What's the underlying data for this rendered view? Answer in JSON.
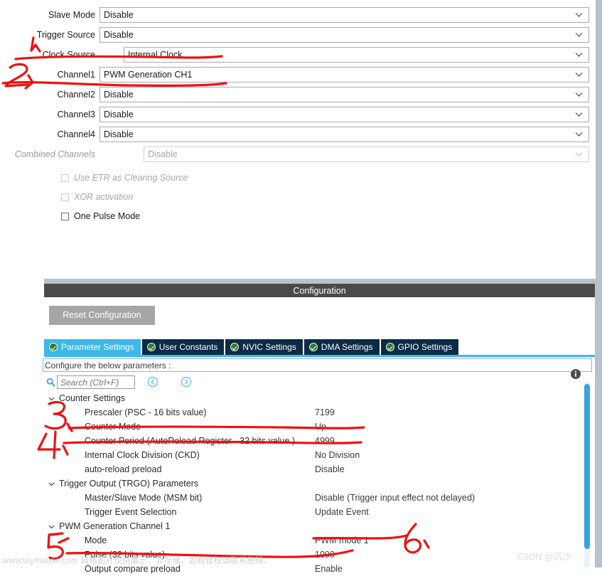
{
  "top_panel": {
    "rows": [
      {
        "label": "Slave Mode",
        "value": "Disable",
        "disabled": false,
        "value_indent": 0
      },
      {
        "label": "Trigger Source",
        "value": "Disable",
        "disabled": false,
        "value_indent": 0
      },
      {
        "label": "Clock Source",
        "value": "Internal Clock",
        "disabled": false,
        "value_indent": 34
      },
      {
        "label": "Channel1",
        "value": "PWM Generation CH1",
        "disabled": false,
        "value_indent": 0
      },
      {
        "label": "Channel2",
        "value": "Disable",
        "disabled": false,
        "value_indent": 0
      },
      {
        "label": "Channel3",
        "value": "Disable",
        "disabled": false,
        "value_indent": 0
      },
      {
        "label": "Channel4",
        "value": "Disable",
        "disabled": false,
        "value_indent": 0
      },
      {
        "label": "Combined Channels",
        "value": "Disable",
        "disabled": true,
        "value_indent": 62
      }
    ],
    "checkboxes": [
      {
        "label": "Use ETR as Clearing Source",
        "checked": false,
        "disabled": true
      },
      {
        "label": "XOR activation",
        "checked": false,
        "disabled": true
      },
      {
        "label": "One Pulse Mode",
        "checked": false,
        "disabled": false
      }
    ]
  },
  "config": {
    "title": "Configuration",
    "reset_button": "Reset Configuration",
    "tabs": [
      {
        "label": "Parameter Settings",
        "active": true
      },
      {
        "label": "User Constants",
        "active": false
      },
      {
        "label": "NVIC Settings",
        "active": false
      },
      {
        "label": "DMA Settings",
        "active": false
      },
      {
        "label": "GPIO Settings",
        "active": false
      }
    ],
    "configure_hint": "Configure the below parameters :",
    "search_placeholder": "Search (Ctrl+F)",
    "tree": [
      {
        "type": "group",
        "name": "Counter Settings",
        "value": "",
        "expanded": true
      },
      {
        "type": "leaf",
        "name": "Prescaler (PSC - 16 bits value)",
        "value": "7199"
      },
      {
        "type": "leaf",
        "name": "Counter Mode",
        "value": "Up"
      },
      {
        "type": "leaf",
        "name": "Counter Period (AutoReload Register - 32 bits value )",
        "value": "4999"
      },
      {
        "type": "leaf",
        "name": "Internal Clock Division (CKD)",
        "value": "No Division"
      },
      {
        "type": "leaf",
        "name": "auto-reload preload",
        "value": "Disable"
      },
      {
        "type": "group",
        "name": "Trigger Output (TRGO) Parameters",
        "value": "",
        "expanded": true
      },
      {
        "type": "leaf",
        "name": "Master/Slave Mode (MSM bit)",
        "value": "Disable (Trigger input effect not delayed)"
      },
      {
        "type": "leaf",
        "name": "Trigger Event Selection",
        "value": "Update Event"
      },
      {
        "type": "group",
        "name": "PWM Generation Channel 1",
        "value": "",
        "expanded": true
      },
      {
        "type": "leaf",
        "name": "Mode",
        "value": "PWM mode 1"
      },
      {
        "type": "leaf",
        "name": "Pulse (32 bits value)",
        "value": "1000"
      },
      {
        "type": "leaf",
        "name": "Output compare preload",
        "value": "Enable"
      }
    ]
  },
  "annotations": {
    "marks": [
      "1",
      "2",
      "3",
      "4",
      "5",
      "6"
    ],
    "color": "#ee1111"
  },
  "watermarks": {
    "toymoban": "www.toymoban.com 网络图片仅供展示，非存储，如有侵权请联系删除。",
    "csdn": "CSDN @沉沙"
  },
  "colors": {
    "accent_blue": "#3fb7e8",
    "tab_inactive": "#0d2a47",
    "header_gray": "#4a4a4a",
    "panel_band": "#b7c2cb",
    "annotation_red": "#ee1111",
    "scroll_thumb": "#3aa3dc"
  }
}
